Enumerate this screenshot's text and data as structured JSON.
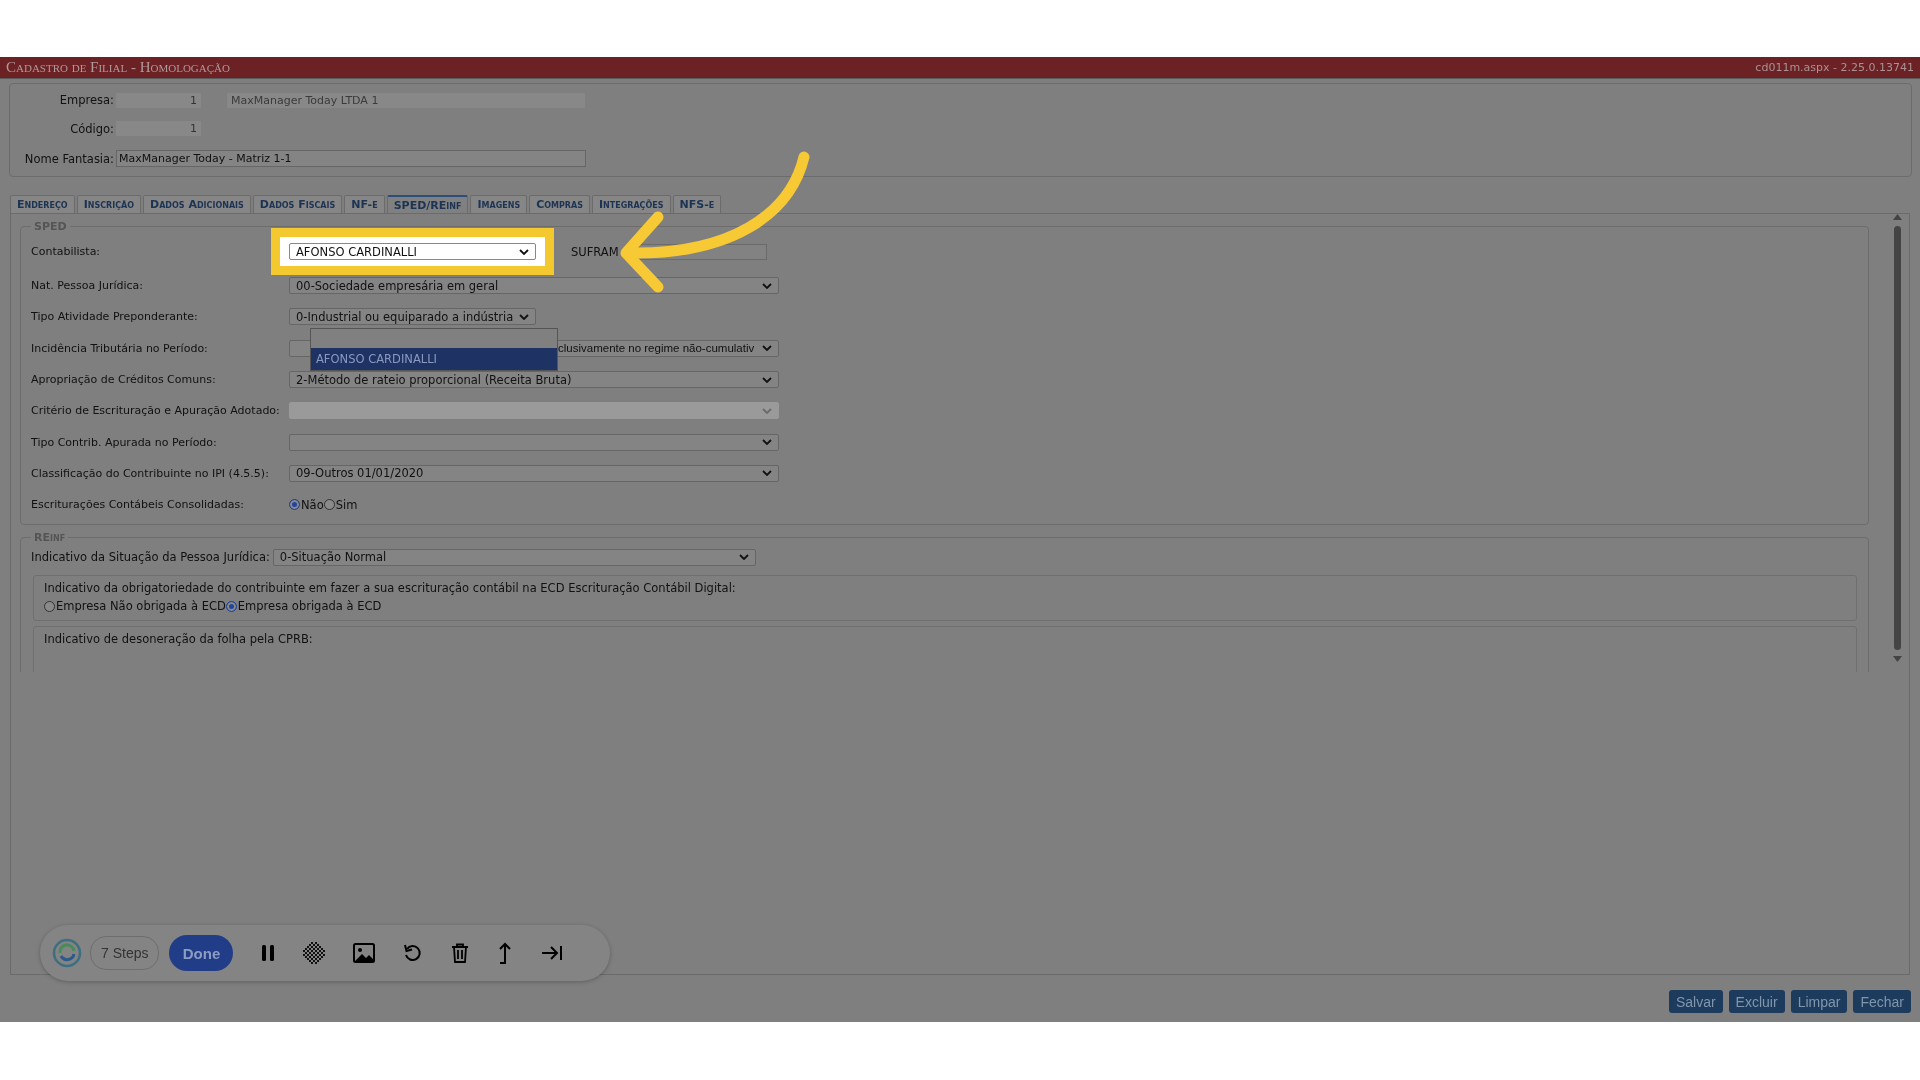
{
  "title_bar": {
    "title": "Cadastro de Filial  - Homologação",
    "version": "cd011m.aspx - 2.25.0.13741"
  },
  "header": {
    "empresa": {
      "label": "Empresa:",
      "code": "1",
      "name": "MaxManager Today LTDA 1"
    },
    "codigo": {
      "label": "Código:",
      "code": "1"
    },
    "nome_fantasia": {
      "label": "Nome Fantasia:",
      "value": "MaxManager Today - Matriz 1-1"
    }
  },
  "tabs": [
    {
      "label": "Endereço",
      "selected": false
    },
    {
      "label": "Inscrição",
      "selected": false
    },
    {
      "label": "Dados Adicionais",
      "selected": false
    },
    {
      "label": "Dados Fiscais",
      "selected": false
    },
    {
      "label": "NF-e",
      "selected": false
    },
    {
      "label": "SPED/REinf",
      "selected": true
    },
    {
      "label": "Imagens",
      "selected": false
    },
    {
      "label": "Compras",
      "selected": false
    },
    {
      "label": "Integrações",
      "selected": false
    },
    {
      "label": "NFS-e",
      "selected": false
    }
  ],
  "sped": {
    "legend": "SPED",
    "rows": [
      {
        "kind": "highlighted",
        "label": "Contabilista:",
        "value": "AFONSO CARDINALLI",
        "side_label": "SUFRAM"
      },
      {
        "kind": "select",
        "label": "Nat. Pessoa Jurídica:",
        "value": "00-Sociedade empresária em geral",
        "disabled": false
      },
      {
        "kind": "narrow",
        "label": "Tipo Atividade Preponderante:",
        "value": "0-Industrial ou equiparado a indústria"
      },
      {
        "kind": "covered",
        "label": "Incidência Tributária no Período:",
        "value": "clusivamente no regime não-cumulativ",
        "disabled": false
      },
      {
        "kind": "select",
        "label": "Apropriação de Créditos Comuns:",
        "value": "2-Método de rateio proporcional (Receita Bruta)",
        "disabled": false
      },
      {
        "kind": "select",
        "label": "Critério de Escrituração e Apuração Adotado:",
        "disabled": true
      },
      {
        "kind": "select",
        "label": "Tipo Contrib. Apurada no Período:",
        "disabled": false
      },
      {
        "kind": "select",
        "label": "Classificação do Contribuinte no IPI (4.5.5):",
        "value": "09-Outros 01/01/2020",
        "disabled": false
      },
      {
        "kind": "radio",
        "label": "Escriturações Contábeis Consolidadas:",
        "options": [
          {
            "label": "Não",
            "selected": true
          },
          {
            "label": "Sim",
            "selected": false
          }
        ]
      }
    ],
    "dropdown": {
      "options": [
        {
          "label": "AFONSO CARDINALLI",
          "selected": true
        }
      ]
    }
  },
  "reinf": {
    "legend": "REinf",
    "situacao": {
      "label": "Indicativo da Situação da Pessoa Jurídica:",
      "value": "0-Situação Normal"
    },
    "ecd": {
      "question": "Indicativo da obrigatoriedade do contribuinte em fazer a sua escrituração contábil na ECD Escrituração Contábil Digital:",
      "options": [
        {
          "label": "Empresa Não obrigada à ECD",
          "selected": false
        },
        {
          "label": "Empresa obrigada à ECD",
          "selected": true
        }
      ]
    },
    "cprb": {
      "question": "Indicativo de desoneração da folha pela CPRB:"
    }
  },
  "toolbar": {
    "steps": "7 Steps",
    "done": "Done"
  },
  "buttons": [
    "Salvar",
    "Excluir",
    "Limpar",
    "Fechar"
  ]
}
